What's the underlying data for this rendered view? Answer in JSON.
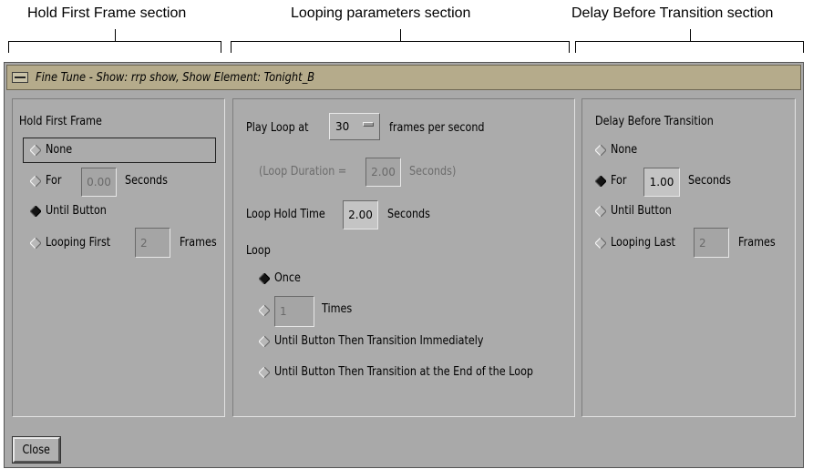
{
  "annotations": {
    "hold_section": "Hold First Frame section",
    "looping_section": "Looping parameters section",
    "delay_section": "Delay Before Transition section"
  },
  "window": {
    "title": "Fine Tune - Show: rrp show, Show Element: Tonight_B"
  },
  "hold": {
    "heading": "Hold First Frame",
    "none_label": "None",
    "for_label": "For",
    "for_value": "0.00",
    "for_unit": "Seconds",
    "until_label": "Until Button",
    "looping_label": "Looping First",
    "looping_value": "2",
    "looping_unit": "Frames",
    "selected": "Until Button"
  },
  "loop": {
    "play_label": "Play Loop at",
    "fps_value": "30",
    "fps_unit": "frames per second",
    "duration_label": "(Loop Duration =",
    "duration_value": "2.00",
    "duration_unit": "Seconds)",
    "hold_time_label": "Loop Hold Time",
    "hold_time_value": "2.00",
    "hold_time_unit": "Seconds",
    "loop_heading": "Loop",
    "once_label": "Once",
    "times_value": "1",
    "times_label": "Times",
    "until_immediate_label": "Until Button Then Transition Immediately",
    "until_end_label": "Until Button Then Transition at the End of the Loop",
    "selected": "Once"
  },
  "delay": {
    "heading": "Delay Before Transition",
    "none_label": "None",
    "for_label": "For",
    "for_value": "1.00",
    "for_unit": "Seconds",
    "until_label": "Until Button",
    "looping_label": "Looping Last",
    "looping_value": "2",
    "looping_unit": "Frames",
    "selected": "For"
  },
  "footer": {
    "close_label": "Close"
  }
}
